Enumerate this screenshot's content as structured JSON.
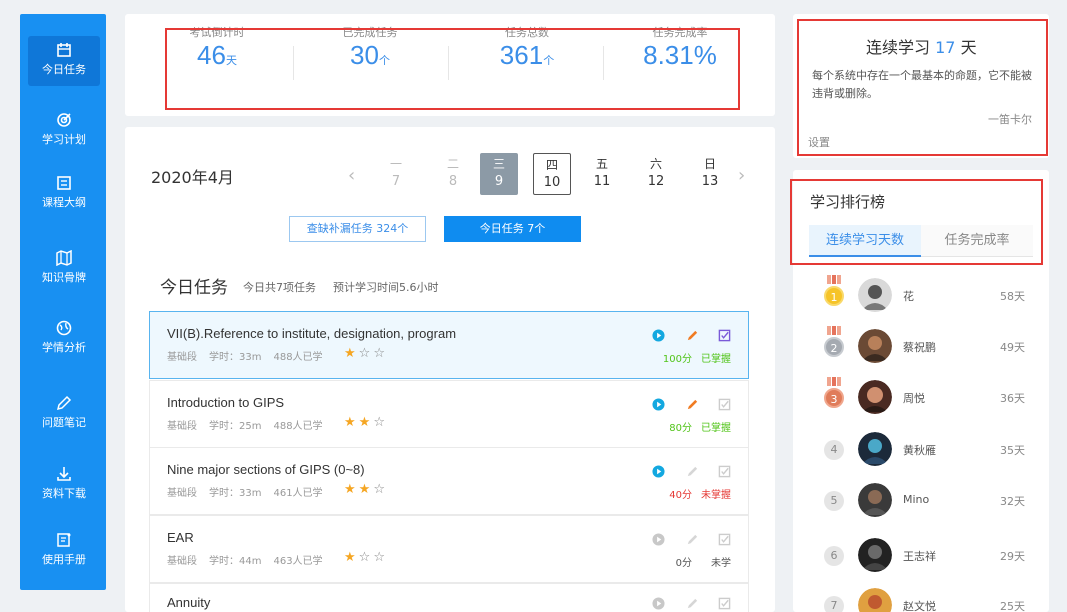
{
  "sidebar": {
    "items": [
      {
        "label": "今日任务",
        "icon": "calendar-icon"
      },
      {
        "label": "学习计划",
        "icon": "target-icon"
      },
      {
        "label": "课程大纲",
        "icon": "outline-icon"
      },
      {
        "label": "知识骨牌",
        "icon": "map-icon"
      },
      {
        "label": "学情分析",
        "icon": "globe-icon"
      },
      {
        "label": "问题笔记",
        "icon": "pencil-icon"
      },
      {
        "label": "资料下载",
        "icon": "download-icon"
      },
      {
        "label": "使用手册",
        "icon": "manual-icon"
      }
    ]
  },
  "stats": {
    "countdown": {
      "label": "考试倒计时",
      "value": "46",
      "unit": "天"
    },
    "completed": {
      "label": "已完成任务",
      "value": "30",
      "unit": "个"
    },
    "total": {
      "label": "任务总数",
      "value": "361",
      "unit": "个"
    },
    "rate": {
      "label": "任务完成率",
      "value": "8.31%"
    }
  },
  "calendar": {
    "month": "2020年4月",
    "days": [
      {
        "dow": "一",
        "num": "7"
      },
      {
        "dow": "二",
        "num": "8"
      },
      {
        "dow": "三",
        "num": "9"
      },
      {
        "dow": "四",
        "num": "10"
      },
      {
        "dow": "五",
        "num": "11"
      },
      {
        "dow": "六",
        "num": "12"
      },
      {
        "dow": "日",
        "num": "13"
      }
    ],
    "prev": "‹",
    "next": "›"
  },
  "buttons": {
    "missing": "查缺补漏任务 324个",
    "today": "今日任务 7个"
  },
  "tasks_header": {
    "title": "今日任务",
    "count_text": "今日共7项任务",
    "time_text": "预计学习时间5.6小时"
  },
  "tasks": [
    {
      "title": "VII(B).Reference to institute, designation, program",
      "stage": "基础段",
      "duration": "学时：33m",
      "learners": "488人已学",
      "score": "100分",
      "status": "已掌握"
    },
    {
      "title": "Introduction to GIPS",
      "stage": "基础段",
      "duration": "学时：25m",
      "learners": "488人已学",
      "score": "80分",
      "status": "已掌握"
    },
    {
      "title": "Nine major sections of GIPS (0~8)",
      "stage": "基础段",
      "duration": "学时：33m",
      "learners": "461人已学",
      "score": "40分",
      "status": "未掌握"
    },
    {
      "title": "EAR",
      "stage": "基础段",
      "duration": "学时：44m",
      "learners": "463人已学",
      "score": "0分",
      "status": "未学"
    },
    {
      "title": "Annuity",
      "stage": "",
      "duration": "",
      "learners": "",
      "score": "",
      "status": ""
    }
  ],
  "streak": {
    "prefix": "连续学习",
    "days": "17",
    "suffix": "天",
    "motto": "每个系统中存在一个最基本的命题，它不能被违背或删除。",
    "author": "一笛卡尔",
    "setting": "设置"
  },
  "ranking": {
    "title": "学习排行榜",
    "tab_active": "连续学习天数",
    "tab_other": "任务完成率",
    "rows": [
      {
        "rank": "1",
        "name": "花",
        "days": "58天"
      },
      {
        "rank": "2",
        "name": "蔡祝鹏",
        "days": "49天"
      },
      {
        "rank": "3",
        "name": "周悦",
        "days": "36天"
      },
      {
        "rank": "4",
        "name": "黄秋雁",
        "days": "35天"
      },
      {
        "rank": "5",
        "name": "Mino",
        "days": "32天"
      },
      {
        "rank": "6",
        "name": "王志祥",
        "days": "29天"
      },
      {
        "rank": "7",
        "name": "赵文悦",
        "days": "25天"
      }
    ]
  },
  "colors": {
    "sidebar": "#1890f2",
    "accent": "#3b8ee8",
    "highlight_box": "#e53935",
    "mastered": "#52c41a",
    "not_mastered": "#e53935"
  }
}
